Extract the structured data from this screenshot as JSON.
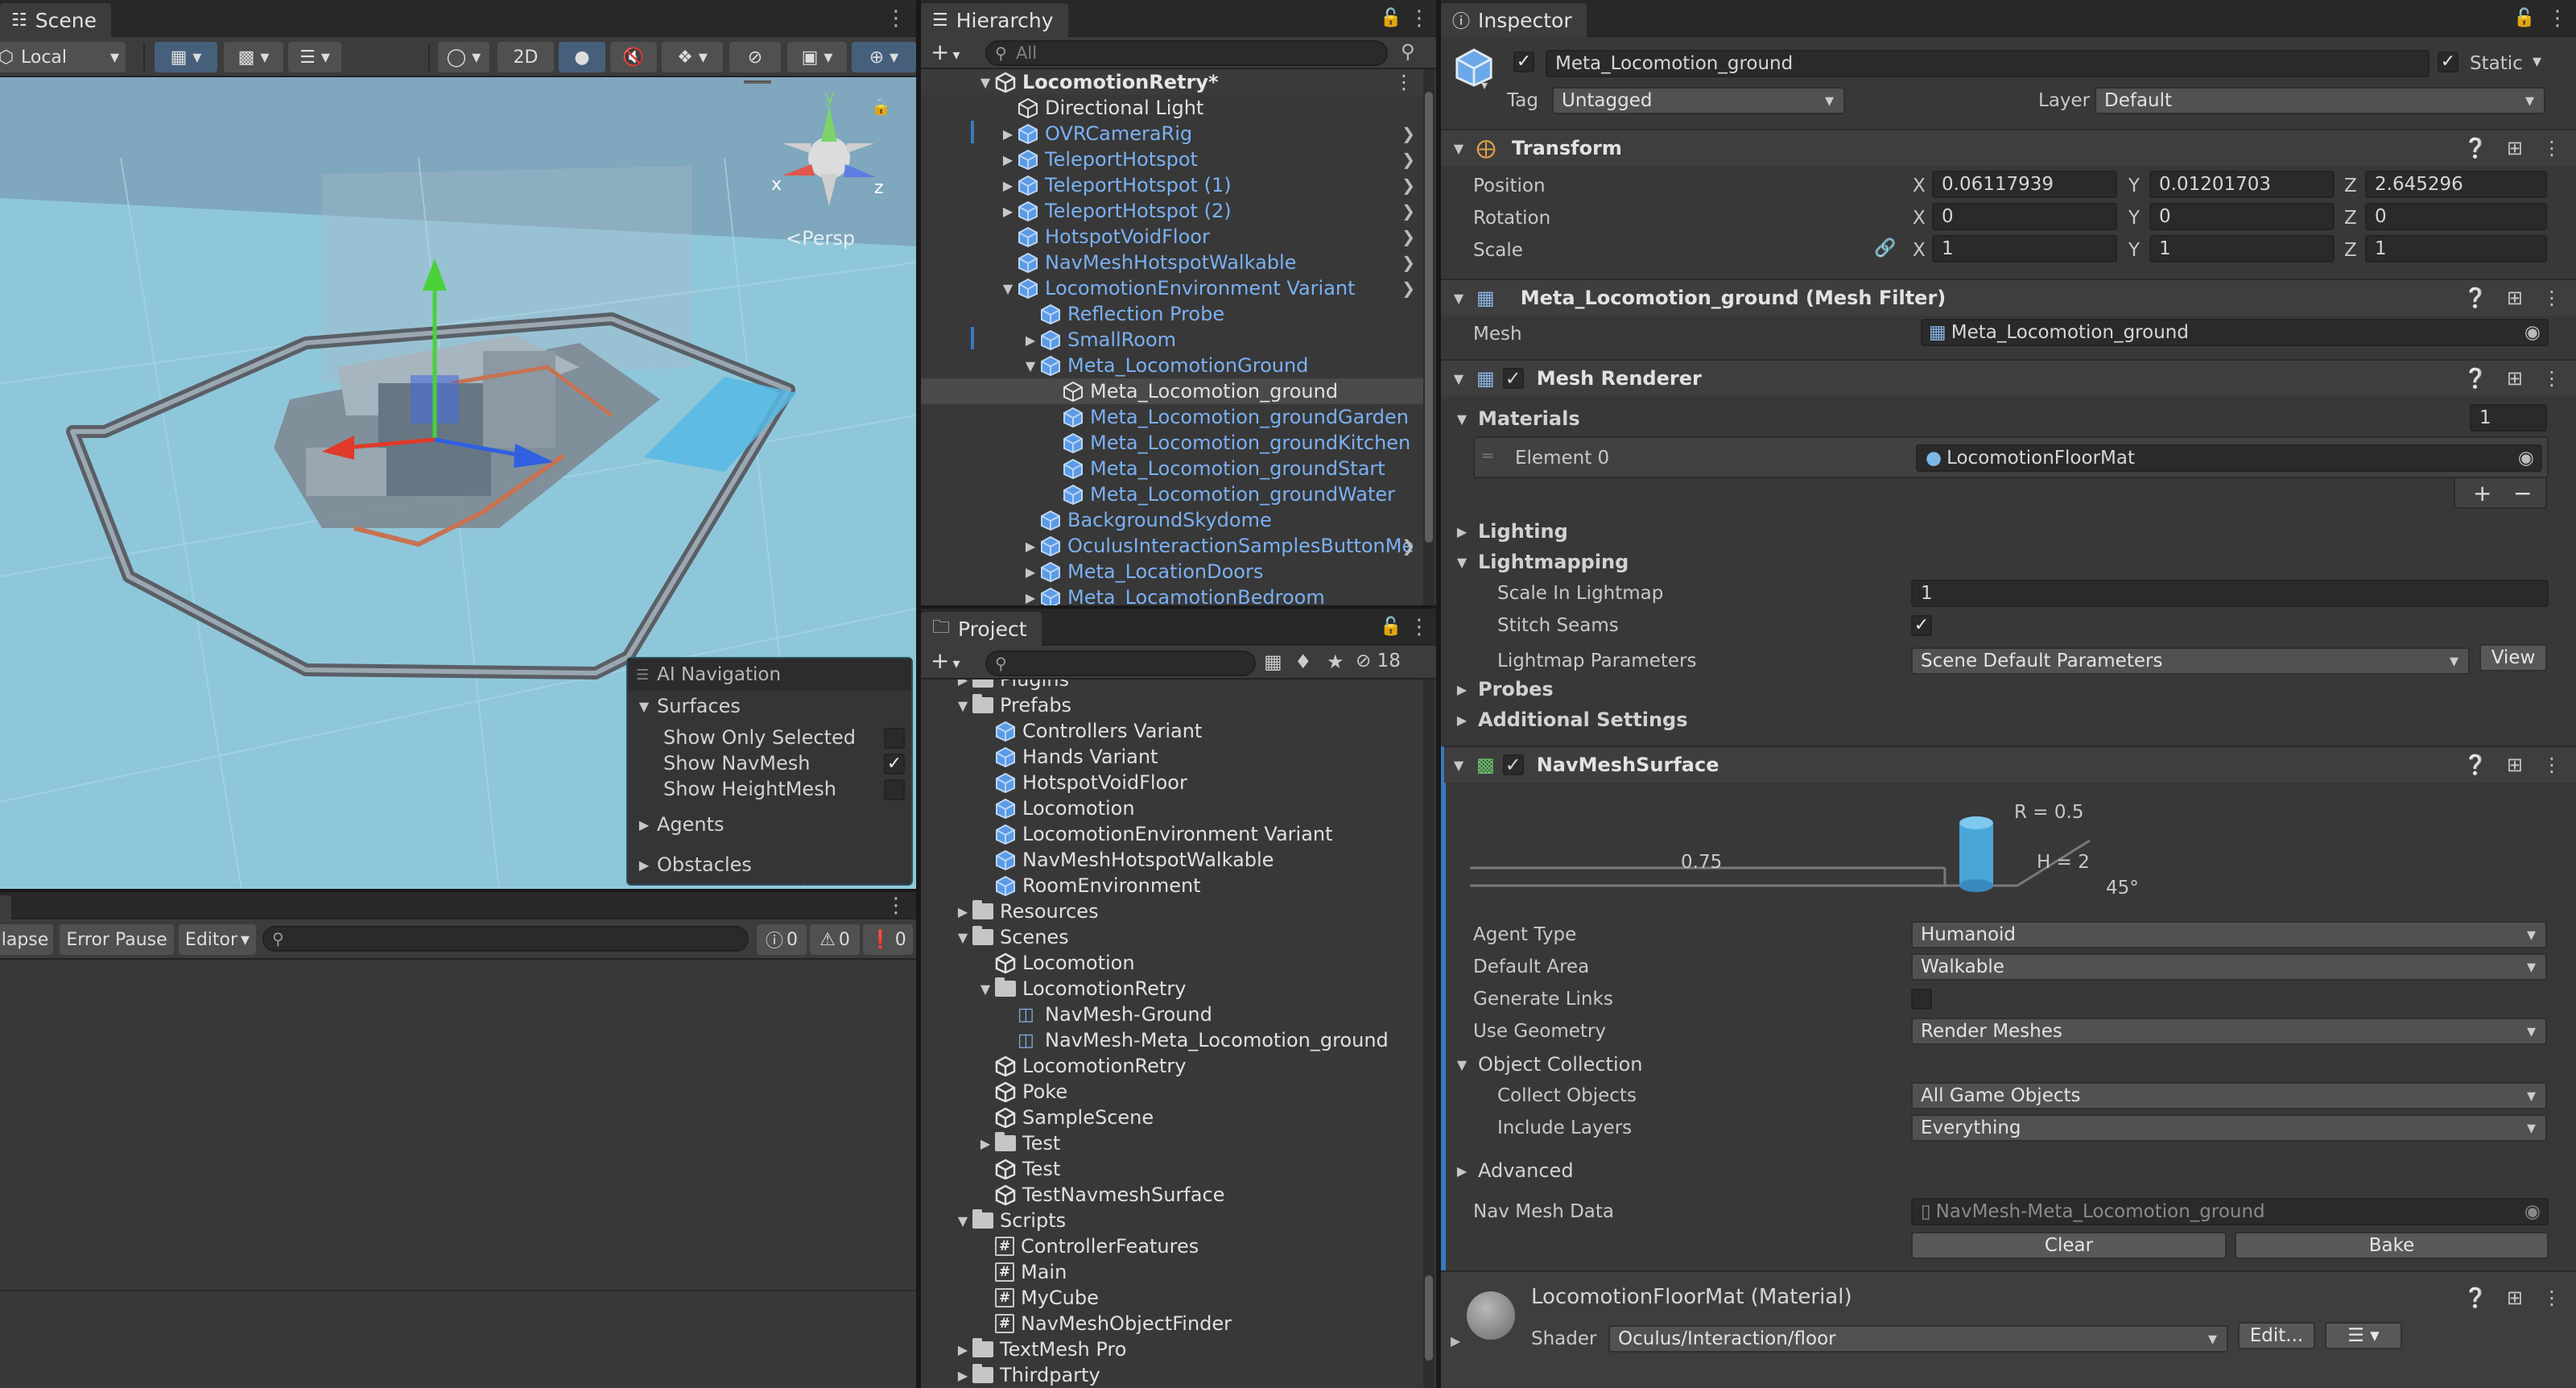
{
  "scene": {
    "tab": "Scene",
    "toolbar": {
      "pivot_mode": "Local",
      "mode_2d": "2D"
    },
    "persp_label": "Persp",
    "ai_nav": {
      "title": "AI Navigation",
      "surfaces": "Surfaces",
      "show_only_selected": "Show Only Selected",
      "show_navmesh": "Show NavMesh",
      "show_heightmesh": "Show HeightMesh",
      "agents": "Agents",
      "obstacles": "Obstacles"
    }
  },
  "console": {
    "collapse": "lapse",
    "error_pause": "Error Pause",
    "editor": "Editor",
    "counts": {
      "logs": "0",
      "warnings": "0",
      "errors": "0"
    }
  },
  "hierarchy": {
    "tab": "Hierarchy",
    "search_placeholder": "All",
    "root": "LocomotionRetry*",
    "items": [
      {
        "label": "Directional Light",
        "indent": 1,
        "arrow": "",
        "color": "white",
        "chev": false
      },
      {
        "label": "OVRCameraRig",
        "indent": 1,
        "arrow": "right",
        "color": "blue",
        "chev": true
      },
      {
        "label": "TeleportHotspot",
        "indent": 1,
        "arrow": "right",
        "color": "blue",
        "chev": true
      },
      {
        "label": "TeleportHotspot (1)",
        "indent": 1,
        "arrow": "right",
        "color": "blue",
        "chev": true
      },
      {
        "label": "TeleportHotspot (2)",
        "indent": 1,
        "arrow": "right",
        "color": "blue",
        "chev": true
      },
      {
        "label": "HotspotVoidFloor",
        "indent": 1,
        "arrow": "",
        "color": "blue",
        "chev": true
      },
      {
        "label": "NavMeshHotspotWalkable",
        "indent": 1,
        "arrow": "",
        "color": "blue",
        "chev": true
      },
      {
        "label": "LocomotionEnvironment Variant",
        "indent": 1,
        "arrow": "down",
        "color": "blue",
        "chev": true
      },
      {
        "label": "Reflection Probe",
        "indent": 2,
        "arrow": "",
        "color": "blue",
        "chev": false
      },
      {
        "label": "SmallRoom",
        "indent": 2,
        "arrow": "right",
        "color": "blue",
        "chev": false
      },
      {
        "label": "Meta_LocomotionGround",
        "indent": 2,
        "arrow": "down",
        "color": "blue",
        "chev": false
      },
      {
        "label": "Meta_Locomotion_ground",
        "indent": 3,
        "arrow": "",
        "color": "white",
        "chev": false,
        "selected": true
      },
      {
        "label": "Meta_Locomotion_groundGarden",
        "indent": 3,
        "arrow": "",
        "color": "blue",
        "chev": false
      },
      {
        "label": "Meta_Locomotion_groundKitchen",
        "indent": 3,
        "arrow": "",
        "color": "blue",
        "chev": false
      },
      {
        "label": "Meta_Locomotion_groundStart",
        "indent": 3,
        "arrow": "",
        "color": "blue",
        "chev": false
      },
      {
        "label": "Meta_Locomotion_groundWater",
        "indent": 3,
        "arrow": "",
        "color": "blue",
        "chev": false
      },
      {
        "label": "BackgroundSkydome",
        "indent": 2,
        "arrow": "",
        "color": "blue",
        "chev": false
      },
      {
        "label": "OculusInteractionSamplesButtonMe",
        "indent": 2,
        "arrow": "right",
        "color": "blue",
        "chev": true
      },
      {
        "label": "Meta_LocationDoors",
        "indent": 2,
        "arrow": "right",
        "color": "blue",
        "chev": false
      },
      {
        "label": "Meta_LocamotionBedroom",
        "indent": 2,
        "arrow": "right",
        "color": "blue",
        "chev": false
      }
    ]
  },
  "project": {
    "tab": "Project",
    "hidden_count": "18",
    "items": [
      {
        "label": "Plugins",
        "indent": 1,
        "arrow": "right",
        "type": "folder"
      },
      {
        "label": "Prefabs",
        "indent": 1,
        "arrow": "down",
        "type": "folder"
      },
      {
        "label": "Controllers Variant",
        "indent": 2,
        "arrow": "",
        "type": "prefab"
      },
      {
        "label": "Hands Variant",
        "indent": 2,
        "arrow": "",
        "type": "prefab"
      },
      {
        "label": "HotspotVoidFloor",
        "indent": 2,
        "arrow": "",
        "type": "prefab"
      },
      {
        "label": "Locomotion",
        "indent": 2,
        "arrow": "",
        "type": "prefab"
      },
      {
        "label": "LocomotionEnvironment Variant",
        "indent": 2,
        "arrow": "",
        "type": "prefab"
      },
      {
        "label": "NavMeshHotspotWalkable",
        "indent": 2,
        "arrow": "",
        "type": "prefab"
      },
      {
        "label": "RoomEnvironment",
        "indent": 2,
        "arrow": "",
        "type": "prefab"
      },
      {
        "label": "Resources",
        "indent": 1,
        "arrow": "right",
        "type": "folder"
      },
      {
        "label": "Scenes",
        "indent": 1,
        "arrow": "down",
        "type": "folder"
      },
      {
        "label": "Locomotion",
        "indent": 2,
        "arrow": "",
        "type": "scene"
      },
      {
        "label": "LocomotionRetry",
        "indent": 2,
        "arrow": "down",
        "type": "folder"
      },
      {
        "label": "NavMesh-Ground",
        "indent": 3,
        "arrow": "",
        "type": "navmesh"
      },
      {
        "label": "NavMesh-Meta_Locomotion_ground",
        "indent": 3,
        "arrow": "",
        "type": "navmesh"
      },
      {
        "label": "LocomotionRetry",
        "indent": 2,
        "arrow": "",
        "type": "scene"
      },
      {
        "label": "Poke",
        "indent": 2,
        "arrow": "",
        "type": "scene"
      },
      {
        "label": "SampleScene",
        "indent": 2,
        "arrow": "",
        "type": "scene"
      },
      {
        "label": "Test",
        "indent": 2,
        "arrow": "right",
        "type": "folder"
      },
      {
        "label": "Test",
        "indent": 2,
        "arrow": "",
        "type": "scene"
      },
      {
        "label": "TestNavmeshSurface",
        "indent": 2,
        "arrow": "",
        "type": "scene"
      },
      {
        "label": "Scripts",
        "indent": 1,
        "arrow": "down",
        "type": "folder"
      },
      {
        "label": "ControllerFeatures",
        "indent": 2,
        "arrow": "",
        "type": "script"
      },
      {
        "label": "Main",
        "indent": 2,
        "arrow": "",
        "type": "script"
      },
      {
        "label": "MyCube",
        "indent": 2,
        "arrow": "",
        "type": "script"
      },
      {
        "label": "NavMeshObjectFinder",
        "indent": 2,
        "arrow": "",
        "type": "script"
      },
      {
        "label": "TextMesh Pro",
        "indent": 1,
        "arrow": "right",
        "type": "folder"
      },
      {
        "label": "Thirdparty",
        "indent": 1,
        "arrow": "right",
        "type": "folder"
      }
    ]
  },
  "inspector": {
    "tab": "Inspector",
    "object_name": "Meta_Locomotion_ground",
    "static_label": "Static",
    "tag_label": "Tag",
    "tag_value": "Untagged",
    "layer_label": "Layer",
    "layer_value": "Default",
    "transform": {
      "title": "Transform",
      "position_label": "Position",
      "rotation_label": "Rotation",
      "scale_label": "Scale",
      "position": {
        "x": "0.06117939",
        "y": "0.01201703",
        "z": "2.645296"
      },
      "rotation": {
        "x": "0",
        "y": "0",
        "z": "0"
      },
      "scale": {
        "x": "1",
        "y": "1",
        "z": "1"
      },
      "axis_x": "X",
      "axis_y": "Y",
      "axis_z": "Z"
    },
    "mesh_filter": {
      "title": "Meta_Locomotion_ground (Mesh Filter)",
      "mesh_label": "Mesh",
      "mesh_value": "Meta_Locomotion_ground"
    },
    "mesh_renderer": {
      "title": "Mesh Renderer",
      "materials_label": "Materials",
      "materials_count": "1",
      "element0_label": "Element 0",
      "element0_value": "LocomotionFloorMat",
      "lighting": "Lighting",
      "lightmapping": "Lightmapping",
      "scale_in_lightmap_label": "Scale In Lightmap",
      "scale_in_lightmap_value": "1",
      "stitch_seams_label": "Stitch Seams",
      "lightmap_params_label": "Lightmap Parameters",
      "lightmap_params_value": "Scene Default Parameters",
      "view_button": "View",
      "probes": "Probes",
      "additional_settings": "Additional Settings"
    },
    "navmesh_surface": {
      "title": "NavMeshSurface",
      "diagram": {
        "r": "R = 0.5",
        "h": "H = 2",
        "step": "0.75",
        "slope": "45°"
      },
      "agent_type_label": "Agent Type",
      "agent_type_value": "Humanoid",
      "default_area_label": "Default Area",
      "default_area_value": "Walkable",
      "generate_links_label": "Generate Links",
      "use_geometry_label": "Use Geometry",
      "use_geometry_value": "Render Meshes",
      "object_collection_label": "Object Collection",
      "collect_objects_label": "Collect Objects",
      "collect_objects_value": "All Game Objects",
      "include_layers_label": "Include Layers",
      "include_layers_value": "Everything",
      "advanced_label": "Advanced",
      "nav_mesh_data_label": "Nav Mesh Data",
      "nav_mesh_data_value": "NavMesh-Meta_Locomotion_ground",
      "clear_button": "Clear",
      "bake_button": "Bake"
    },
    "material": {
      "title": "LocomotionFloorMat (Material)",
      "shader_label": "Shader",
      "shader_value": "Oculus/Interaction/floor",
      "edit_button": "Edit..."
    }
  },
  "colors": {
    "accent": "#3a79bb",
    "scene_water": "#89c4d8",
    "link_blue": "#7bb0f2",
    "panel_bg": "#383838"
  }
}
